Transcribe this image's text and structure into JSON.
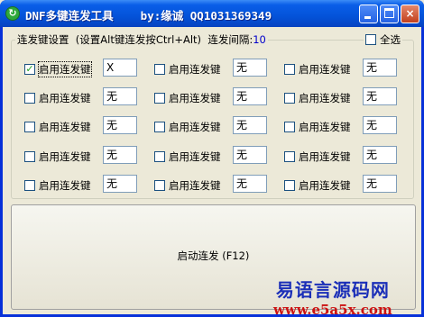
{
  "window": {
    "title": "DNF多键连发工具    by:缘诚 QQ1031369349",
    "controls": {
      "minimize": "—",
      "maximize": "□",
      "close": "×"
    }
  },
  "group": {
    "label": "连发键设置  (设置Alt键连发按Ctrl+Alt)",
    "interval_label": "连发间隔:",
    "interval_value": "10",
    "select_all_label": "全选",
    "select_all_checked": false
  },
  "items": [
    {
      "label": "启用连发键",
      "checked": true,
      "key": "X"
    },
    {
      "label": "启用连发键",
      "checked": false,
      "key": "无"
    },
    {
      "label": "启用连发键",
      "checked": false,
      "key": "无"
    },
    {
      "label": "启用连发键",
      "checked": false,
      "key": "无"
    },
    {
      "label": "启用连发键",
      "checked": false,
      "key": "无"
    },
    {
      "label": "启用连发键",
      "checked": false,
      "key": "无"
    },
    {
      "label": "启用连发键",
      "checked": false,
      "key": "无"
    },
    {
      "label": "启用连发键",
      "checked": false,
      "key": "无"
    },
    {
      "label": "启用连发键",
      "checked": false,
      "key": "无"
    },
    {
      "label": "启用连发键",
      "checked": false,
      "key": "无"
    },
    {
      "label": "启用连发键",
      "checked": false,
      "key": "无"
    },
    {
      "label": "启用连发键",
      "checked": false,
      "key": "无"
    },
    {
      "label": "启用连发键",
      "checked": false,
      "key": "无"
    },
    {
      "label": "启用连发键",
      "checked": false,
      "key": "无"
    },
    {
      "label": "启用连发键",
      "checked": false,
      "key": "无"
    }
  ],
  "start_button": {
    "label": "启动连发 (F12)"
  },
  "watermark": {
    "line1": "易语言源码网",
    "line2": "www.e5a5x.com"
  }
}
